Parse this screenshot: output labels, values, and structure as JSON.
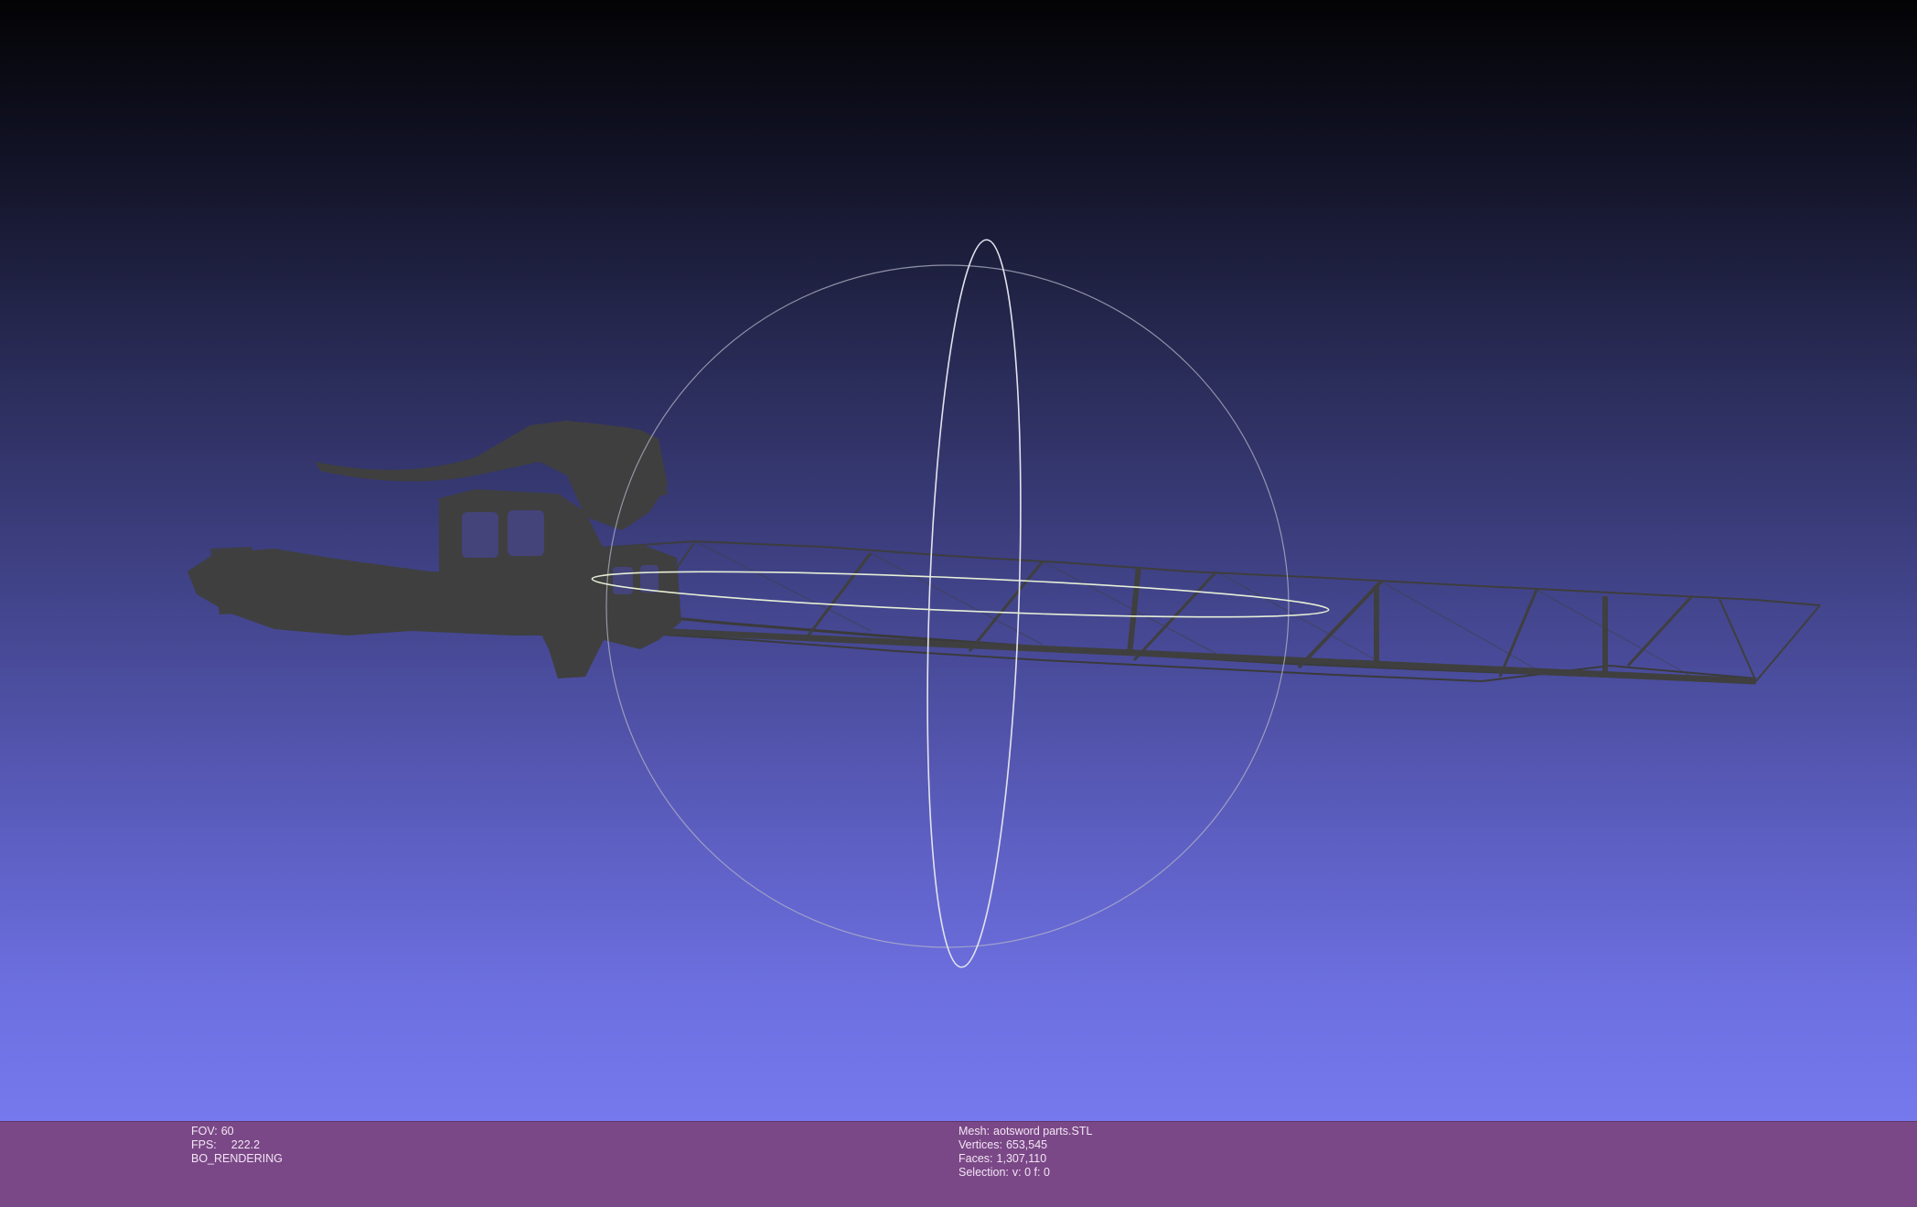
{
  "viewer": {
    "colors": {
      "background_top": "#030305",
      "background_bottom": "#7579ec",
      "info_bar": "#7b4887",
      "model": "#3f3f3f",
      "trackball": "#c8c8d2"
    },
    "trackball_icon": "trackball-gizmo-icon",
    "model_name": "sword-mesh-icon"
  },
  "info": {
    "fov_label": "FOV:",
    "fov_value": "60",
    "fps_label": "FPS:",
    "fps_value": "222.2",
    "render_mode": "BO_RENDERING",
    "mesh_label": "Mesh:",
    "mesh_value": "aotsword parts.STL",
    "vertices_label": "Vertices:",
    "vertices_value": "653,545",
    "faces_label": "Faces:",
    "faces_value": "1,307,110",
    "selection_label": "Selection:",
    "selection_value": "v: 0 f: 0"
  }
}
